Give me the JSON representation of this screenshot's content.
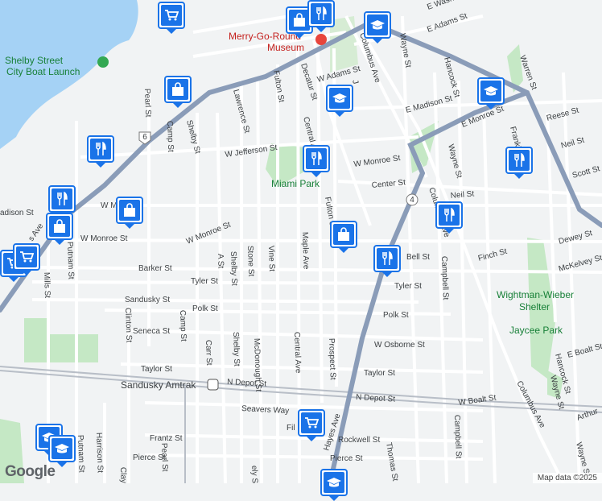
{
  "colors": {
    "water": "#a5d2f5",
    "park": "#c5e8c5",
    "land": "#f1f3f4",
    "road": "#ffffff",
    "highway": "#8a9cb8",
    "rail": "#b8bec7",
    "pin": "#1a73e8",
    "park_text": "#188038",
    "poi_text": "#c5221f"
  },
  "places": {
    "merry_go_round": "Merry-Go-Round",
    "museum": "Museum",
    "shelby_launch_1": "Shelby Street",
    "shelby_launch_2": "City Boat Launch",
    "miami_park": "Miami Park",
    "wightman_wieber": "Wightman-Wieber",
    "shelter": "Shelter",
    "jaycee_park": "Jaycee Park",
    "amtrak": "Sandusky Amtrak"
  },
  "streets": {
    "e_washington": "E Wash",
    "e_adams": "E Adams St",
    "w_adams": "W Adams St",
    "e_madison": "E Madison St",
    "e_monroe": "E Monroe St",
    "w_monroe_1": "W Monroe St",
    "w_monroe_2": "W Monroe St",
    "w_monroe_3": "W Monroe St",
    "w_jefferson": "W Jefferson St",
    "center": "Center St",
    "madison_w": "adison St",
    "w_m": "W M",
    "neil_1": "Neil St",
    "neil_2": "Neil St",
    "scott": "Scott St",
    "reese": "Reese St",
    "dewey": "Dewey St",
    "mckelvey": "McKelvey St",
    "finch": "Finch St",
    "bell": "Bell St",
    "barker": "Barker St",
    "tyler_1": "Tyler St",
    "tyler_2": "Tyler St",
    "sandusky": "Sandusky St",
    "polk_1": "Polk St",
    "polk_2": "Polk St",
    "seneca": "Seneca St",
    "w_osborne": "W Osborne St",
    "taylor_1": "Taylor St",
    "taylor_2": "Taylor St",
    "n_depot_1": "N Depot St",
    "n_depot_2": "N Depot St",
    "w_boalt": "W Boalt St",
    "e_boalt": "E Boalt St",
    "seavers": "Seavers Way",
    "rockwell": "Rockwell St",
    "pierce_1": "Pierce St",
    "pierce_2": "Pierce St",
    "frantz": "Frantz St",
    "arthur": "Arthur",
    "fil": "Fil",
    "warren": "Warren St",
    "hancock_1": "Hancock St",
    "hancock_2": "Hancock St",
    "franklin": "Franklin St",
    "wayne_1": "Wayne St",
    "wayne_2": "Wayne St",
    "wayne_3": "Wayne St",
    "wayne_4": "Wayne St",
    "columbus_1": "Columbus Ave",
    "columbus_2": "Columbus Ave",
    "columbus_3": "Columbus Ave",
    "campbell_1": "Campbell St",
    "campbell_2": "Campbell St",
    "thomas": "Thomas St",
    "hayes": "Hayes Ave",
    "prospect": "Prospect St",
    "central_1": "Central Ave",
    "central_2": "Central Ave",
    "maple": "Maple Ave",
    "vine": "Vine St",
    "stone": "Stone St",
    "shelby_1": "Shelby St",
    "shelby_2": "Shelby St",
    "shelby_3": "Shelby St",
    "a_st": "A St",
    "lawrence": "Lawrence St",
    "fulton_1": "Fulton St",
    "fulton_2": "Fulton St",
    "decatur": "Decatur St",
    "camp_1": "Camp St",
    "camp_2": "Camp St",
    "pearl_1": "Pearl St",
    "pearl_2": "Pearl St",
    "putnam_1": "Putnam St",
    "putnam_2": "Putnam St",
    "mills": "Mills St",
    "clinton": "Clinton St",
    "carr": "Carr St",
    "mcdonough": "McDonough St",
    "harrison": "Harrison St",
    "clay": "Clay",
    "ely": "ely St",
    "columbus_ave_short": "s Ave",
    "j": "J"
  },
  "shields": {
    "route_6": "6",
    "route_4": "4"
  },
  "pins": [
    {
      "name": "shopping-pin",
      "icon": "shopping-cart-icon"
    },
    {
      "name": "shopping-pin",
      "icon": "shopping-bag-icon"
    },
    {
      "name": "school-pin",
      "icon": "graduation-cap-icon"
    },
    {
      "name": "restaurant-pin",
      "icon": "fork-knife-icon"
    },
    {
      "name": "shopping-pin",
      "icon": "shopping-bag-icon"
    },
    {
      "name": "school-pin",
      "icon": "graduation-cap-icon"
    },
    {
      "name": "school-pin",
      "icon": "graduation-cap-icon"
    },
    {
      "name": "restaurant-pin",
      "icon": "fork-knife-icon"
    },
    {
      "name": "restaurant-pin",
      "icon": "fork-knife-icon"
    },
    {
      "name": "restaurant-pin",
      "icon": "fork-knife-icon"
    },
    {
      "name": "restaurant-pin",
      "icon": "fork-knife-icon"
    },
    {
      "name": "shopping-pin",
      "icon": "shopping-bag-icon"
    },
    {
      "name": "shopping-pin",
      "icon": "shopping-bag-icon"
    },
    {
      "name": "restaurant-pin",
      "icon": "fork-knife-icon"
    },
    {
      "name": "shopping-pin",
      "icon": "shopping-bag-icon"
    },
    {
      "name": "restaurant-pin",
      "icon": "fork-knife-icon"
    },
    {
      "name": "shopping-pin",
      "icon": "shopping-cart-icon"
    },
    {
      "name": "shopping-pin",
      "icon": "shopping-cart-icon"
    },
    {
      "name": "school-pin",
      "icon": "graduation-cap-icon"
    },
    {
      "name": "school-pin",
      "icon": "graduation-cap-icon"
    },
    {
      "name": "shopping-pin",
      "icon": "shopping-cart-icon"
    },
    {
      "name": "school-pin",
      "icon": "graduation-cap-icon"
    }
  ],
  "footer": {
    "logo": "Google",
    "attribution": "Map data ©2025"
  }
}
